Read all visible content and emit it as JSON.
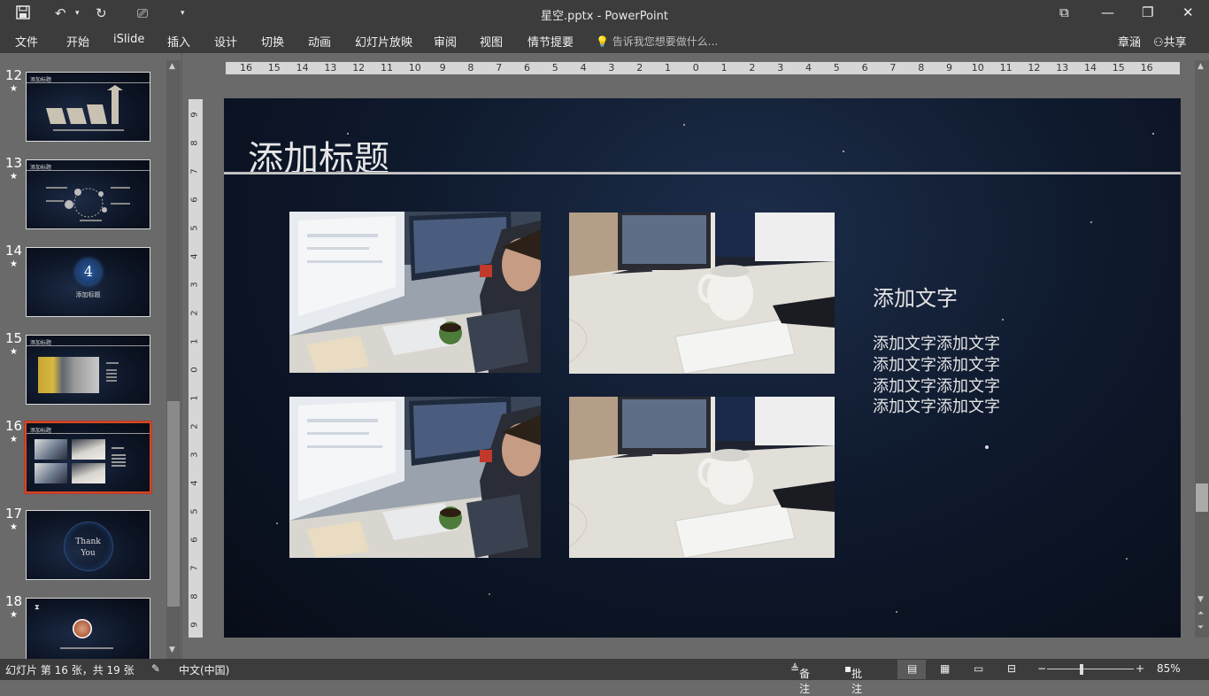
{
  "window": {
    "title": "星空.pptx - PowerPoint",
    "controls": [
      "restore-ribbon",
      "minimize",
      "maximize",
      "close"
    ]
  },
  "ribbon": {
    "tabs": [
      "文件",
      "开始",
      "iSlide",
      "插入",
      "设计",
      "切换",
      "动画",
      "幻灯片放映",
      "审阅",
      "视图",
      "情节提要"
    ],
    "tell_me": "告诉我您想要做什么...",
    "user": "章涵",
    "share": "共享"
  },
  "thumbnails": [
    {
      "num": "12",
      "title": "添加标题"
    },
    {
      "num": "13",
      "title": "添加标题"
    },
    {
      "num": "14",
      "center_num": "4",
      "caption": "添加标题"
    },
    {
      "num": "15",
      "title": "添加标题"
    },
    {
      "num": "16",
      "title": "添加标题",
      "selected": true
    },
    {
      "num": "17",
      "text1": "Thank",
      "text2": "You"
    },
    {
      "num": "18"
    }
  ],
  "ruler": {
    "horizontal": [
      "16",
      "15",
      "14",
      "13",
      "12",
      "11",
      "10",
      "9",
      "8",
      "7",
      "6",
      "5",
      "4",
      "3",
      "2",
      "1",
      "0",
      "1",
      "2",
      "3",
      "4",
      "5",
      "6",
      "7",
      "8",
      "9",
      "10",
      "11",
      "12",
      "13",
      "14",
      "15",
      "16"
    ],
    "vertical": [
      "9",
      "8",
      "7",
      "6",
      "5",
      "4",
      "3",
      "2",
      "1",
      "0",
      "1",
      "2",
      "3",
      "4",
      "5",
      "6",
      "7",
      "8",
      "9"
    ]
  },
  "slide": {
    "title": "添加标题",
    "subtitle": "添加文字",
    "body_lines": [
      "添加文字添加文字",
      "添加文字添加文字",
      "添加文字添加文字",
      "添加文字添加文字"
    ]
  },
  "status": {
    "slide_info": "幻灯片 第 16 张，共 19 张",
    "language": "中文(中国)",
    "notes": "备注",
    "comments": "批注",
    "zoom": "85%"
  }
}
